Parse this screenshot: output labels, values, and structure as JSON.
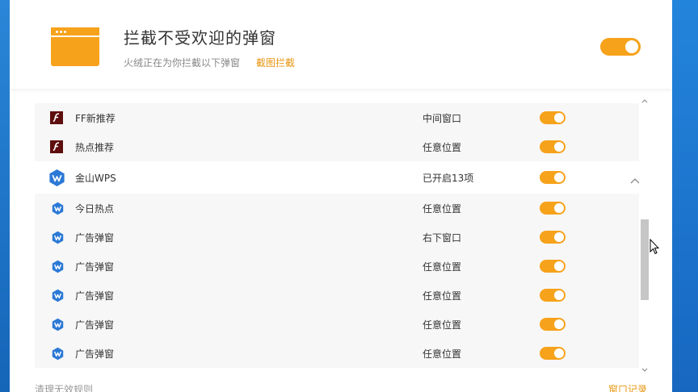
{
  "header": {
    "title": "拦截不受欢迎的弹窗",
    "subtitle": "火绒正在为你拦截以下弹窗",
    "screenshot_link": "截图拦截",
    "master_toggle_on": true
  },
  "rows": [
    {
      "name": "FF新推荐",
      "status": "中间窗口",
      "icon": "flash-icon",
      "enabled": true
    },
    {
      "name": "热点推荐",
      "status": "任意位置",
      "icon": "flash-icon",
      "enabled": true
    },
    {
      "name": "金山WPS",
      "status": "已开启13项",
      "icon": "wps-icon",
      "enabled": true,
      "expanded": true
    },
    {
      "name": "今日热点",
      "status": "任意位置",
      "icon": "wps-icon",
      "enabled": true
    },
    {
      "name": "广告弹窗",
      "status": "右下窗口",
      "icon": "wps-icon",
      "enabled": true
    },
    {
      "name": "广告弹窗",
      "status": "任意位置",
      "icon": "wps-icon",
      "enabled": true
    },
    {
      "name": "广告弹窗",
      "status": "任意位置",
      "icon": "wps-icon",
      "enabled": true
    },
    {
      "name": "广告弹窗",
      "status": "任意位置",
      "icon": "wps-icon",
      "enabled": true
    },
    {
      "name": "广告弹窗",
      "status": "任意位置",
      "icon": "wps-icon",
      "enabled": true
    }
  ],
  "footer": {
    "clear_invalid": "清理无效规则",
    "popup_log": "窗口记录"
  },
  "colors": {
    "accent": "#f7a21b",
    "link": "#e8950f",
    "flash_icon": "#5e0e0e",
    "wps_icon": "#2b79d6",
    "desktop": "#1a6fc4"
  }
}
